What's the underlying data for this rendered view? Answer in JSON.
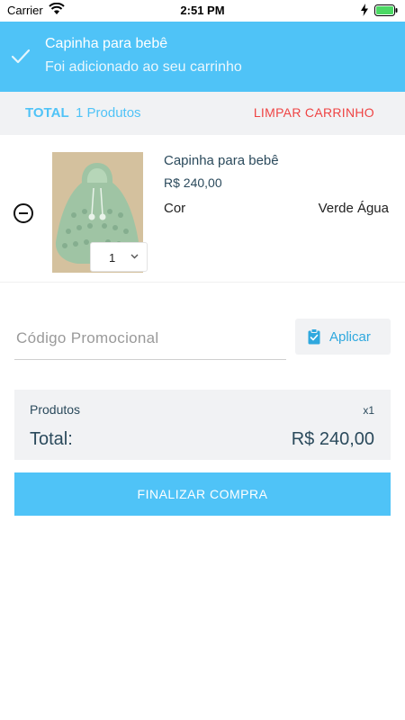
{
  "status_bar": {
    "carrier": "Carrier",
    "time": "2:51 PM"
  },
  "notification": {
    "title": "Capinha para bebê",
    "message": "Foi adicionado ao seu carrinho",
    "icon": "checkmark-icon"
  },
  "cart_header": {
    "total_label": "TOTAL",
    "items_count": "1 Produtos",
    "clear_label": "LIMPAR CARRINHO"
  },
  "cart_items": [
    {
      "name": "Capinha para bebê",
      "price": "R$ 240,00",
      "attribute_label": "Cor",
      "attribute_value": "Verde Água",
      "quantity": "1"
    }
  ],
  "promo": {
    "placeholder": "Código Promocional",
    "apply_label": "Aplicar"
  },
  "summary": {
    "products_label": "Produtos",
    "quantity": "x1",
    "total_label": "Total:",
    "total_value": "R$ 240,00"
  },
  "checkout": {
    "label": "FINALIZAR COMPRA"
  },
  "colors": {
    "accent": "#4fc3f7",
    "danger": "#ef4444",
    "panel": "#f1f2f4",
    "text": "#2b4a5c"
  }
}
